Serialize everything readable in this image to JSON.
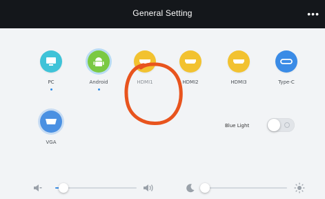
{
  "header": {
    "title": "General Setting",
    "more_label": "•••"
  },
  "sources": [
    {
      "label": "PC",
      "icon": "monitor-icon",
      "color": "#3fc3d8",
      "active": true
    },
    {
      "label": "Android",
      "icon": "android-icon",
      "color": "#7ac943",
      "active": true
    },
    {
      "label": "HDMI1",
      "icon": "hdmi-port-icon",
      "color": "#f2c230",
      "active": false
    },
    {
      "label": "HDMI2",
      "icon": "hdmi-port-icon",
      "color": "#f2c230",
      "active": false
    },
    {
      "label": "HDMI3",
      "icon": "hdmi-port-icon",
      "color": "#f2c230",
      "active": false
    },
    {
      "label": "Type-C",
      "icon": "usb-c-icon",
      "color": "#3a8be6",
      "active": false
    },
    {
      "label": "VGA",
      "icon": "vga-port-icon",
      "color": "#4a90e2",
      "active": false
    }
  ],
  "blue_light": {
    "label": "Blue Light",
    "on": false
  },
  "volume": {
    "level": 0.1
  },
  "brightness": {
    "level": 0.05
  },
  "annotation": {
    "color": "#e8541e"
  }
}
